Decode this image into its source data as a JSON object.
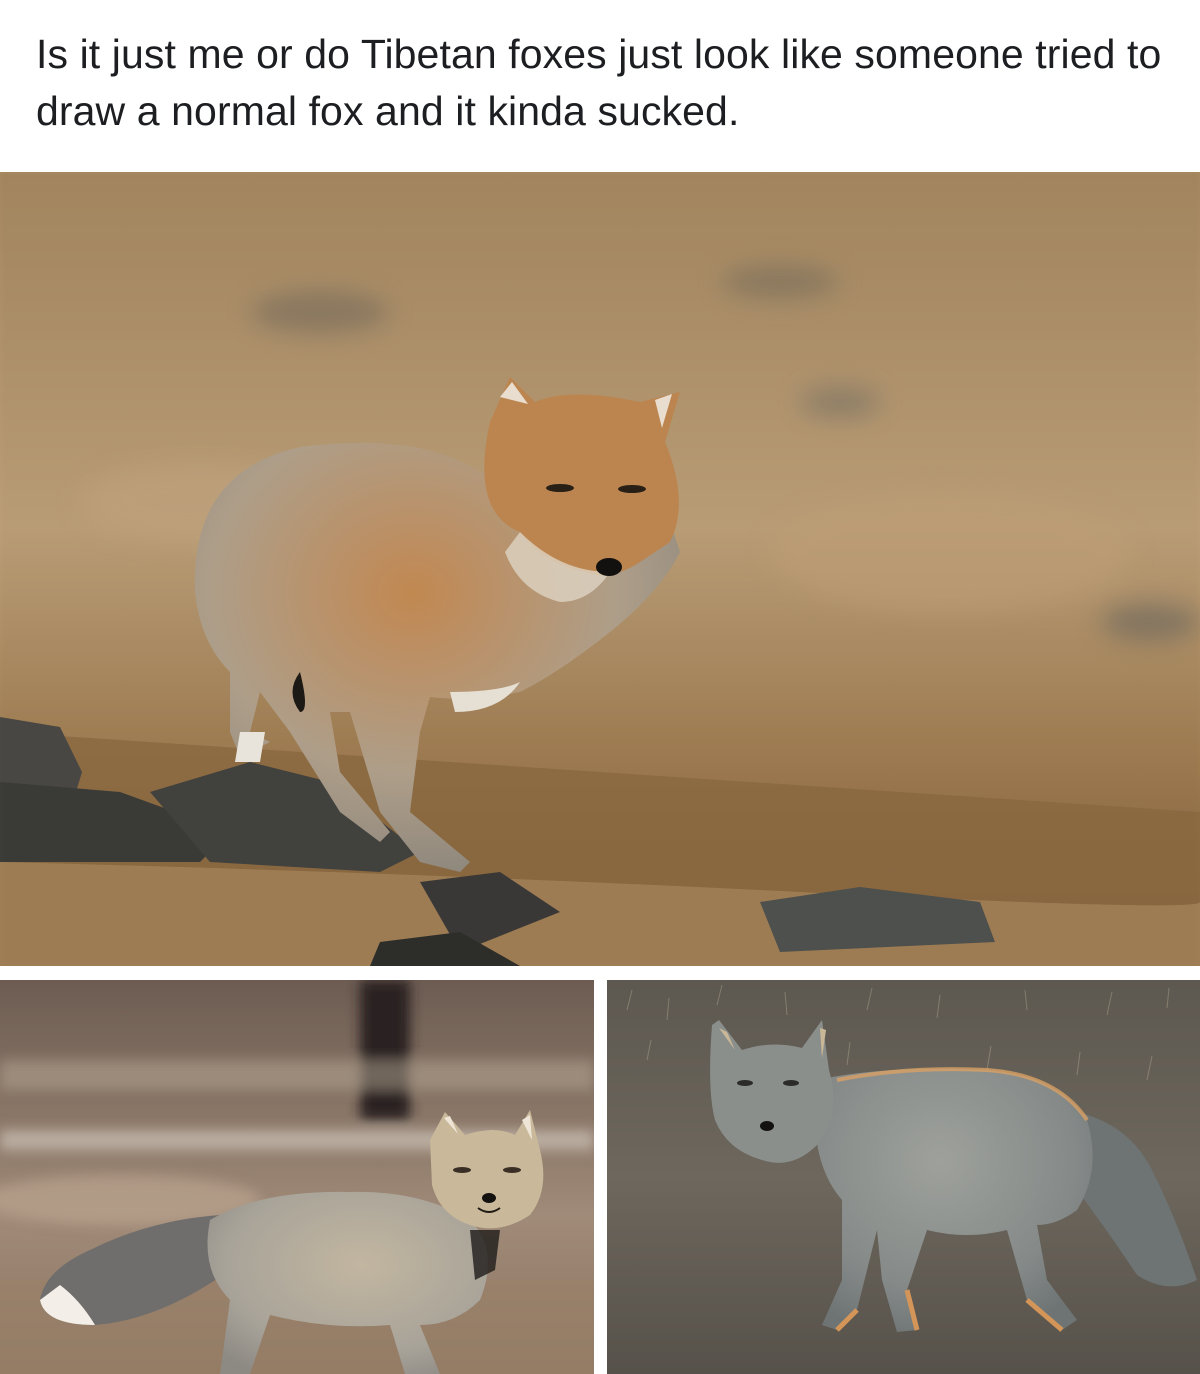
{
  "post": {
    "caption": "Is it just me or do Tibetan foxes just look like someone tried to draw a normal fox and it kinda sucked."
  },
  "photos": [
    {
      "subject": "tibetan-fox-standing-on-rocks",
      "palette": {
        "background": "#b89a70",
        "fur": "#c7925c",
        "fur_gray": "#a9a396",
        "ground": "#8b6c46"
      }
    },
    {
      "subject": "tibetan-fox-side-view-bushy-tail",
      "palette": {
        "background": "#8e7a6a",
        "fur": "#b6a995",
        "fur_gray": "#9e9a92",
        "ground": "#a48d76"
      }
    },
    {
      "subject": "tibetan-fox-gray-backlit",
      "palette": {
        "background": "#6e6a60",
        "fur": "#8c8f8a",
        "fur_gray": "#7f8584",
        "ground": "#5f5a52"
      }
    }
  ]
}
